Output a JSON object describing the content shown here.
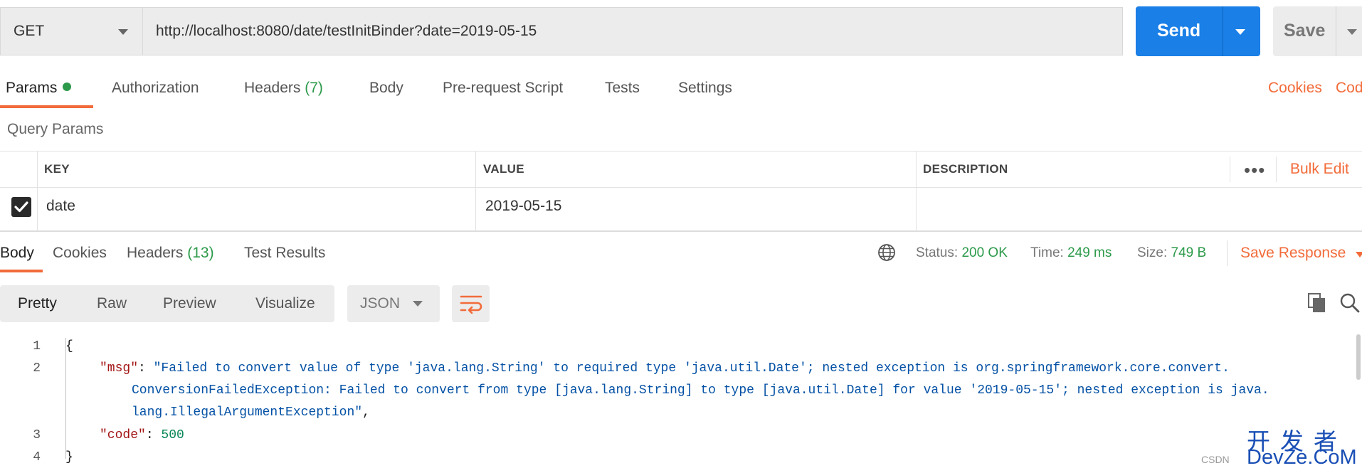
{
  "request": {
    "method": "GET",
    "url": "http://localhost:8080/date/testInitBinder?date=2019-05-15",
    "send_label": "Send",
    "save_label": "Save"
  },
  "request_tabs": {
    "params": "Params",
    "authorization": "Authorization",
    "headers": "Headers",
    "headers_count": "(7)",
    "body": "Body",
    "prerequest": "Pre-request Script",
    "tests": "Tests",
    "settings": "Settings",
    "cookies": "Cookies",
    "code": "Cod"
  },
  "query_params": {
    "title": "Query Params",
    "columns": {
      "key": "KEY",
      "value": "VALUE",
      "description": "DESCRIPTION"
    },
    "more": "•••",
    "bulk_edit": "Bulk Edit",
    "rows": [
      {
        "checked": true,
        "key": "date",
        "value": "2019-05-15",
        "description": ""
      }
    ]
  },
  "response_tabs": {
    "body": "Body",
    "cookies": "Cookies",
    "headers": "Headers",
    "headers_count": "(13)",
    "test_results": "Test Results"
  },
  "response_status": {
    "status_label": "Status:",
    "status_value": "200 OK",
    "time_label": "Time:",
    "time_value": "249 ms",
    "size_label": "Size:",
    "size_value": "749 B",
    "save_response": "Save Response"
  },
  "view_options": {
    "pretty": "Pretty",
    "raw": "Raw",
    "preview": "Preview",
    "visualize": "Visualize",
    "format": "JSON"
  },
  "response_body": {
    "line_numbers": [
      "1",
      "2",
      "3",
      "4"
    ],
    "open_brace": "{",
    "close_brace": "}",
    "msg_key": "\"msg\"",
    "msg_line1": "\"Failed to convert value of type 'java.lang.String' to required type 'java.util.Date'; nested exception is org.springframework.core.convert.",
    "msg_line2": "ConversionFailedException: Failed to convert from type [java.lang.String] to type [java.util.Date] for value '2019-05-15'; nested exception is java.",
    "msg_line3": "lang.IllegalArgumentException\"",
    "code_key": "\"code\"",
    "code_value": "500",
    "colon": ": ",
    "comma": ","
  },
  "watermark": {
    "cn": "开发者",
    "en": "DevZe.CoM",
    "csdn": "CSDN"
  },
  "colors": {
    "accent": "#f26b3a",
    "send_blue": "#1a7fe6",
    "status_green": "#2c9a4a"
  }
}
